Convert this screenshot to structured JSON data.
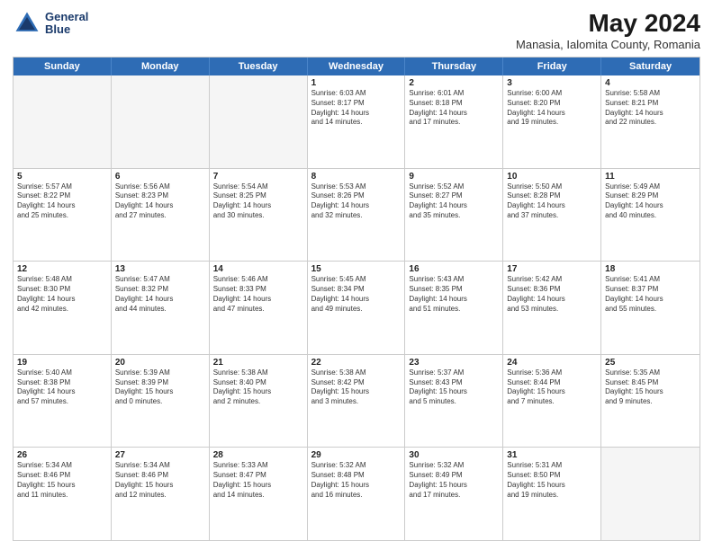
{
  "header": {
    "logo_line1": "General",
    "logo_line2": "Blue",
    "main_title": "May 2024",
    "subtitle": "Manasia, Ialomita County, Romania"
  },
  "day_headers": [
    "Sunday",
    "Monday",
    "Tuesday",
    "Wednesday",
    "Thursday",
    "Friday",
    "Saturday"
  ],
  "weeks": [
    [
      {
        "num": "",
        "info": ""
      },
      {
        "num": "",
        "info": ""
      },
      {
        "num": "",
        "info": ""
      },
      {
        "num": "1",
        "info": "Sunrise: 6:03 AM\nSunset: 8:17 PM\nDaylight: 14 hours\nand 14 minutes."
      },
      {
        "num": "2",
        "info": "Sunrise: 6:01 AM\nSunset: 8:18 PM\nDaylight: 14 hours\nand 17 minutes."
      },
      {
        "num": "3",
        "info": "Sunrise: 6:00 AM\nSunset: 8:20 PM\nDaylight: 14 hours\nand 19 minutes."
      },
      {
        "num": "4",
        "info": "Sunrise: 5:58 AM\nSunset: 8:21 PM\nDaylight: 14 hours\nand 22 minutes."
      }
    ],
    [
      {
        "num": "5",
        "info": "Sunrise: 5:57 AM\nSunset: 8:22 PM\nDaylight: 14 hours\nand 25 minutes."
      },
      {
        "num": "6",
        "info": "Sunrise: 5:56 AM\nSunset: 8:23 PM\nDaylight: 14 hours\nand 27 minutes."
      },
      {
        "num": "7",
        "info": "Sunrise: 5:54 AM\nSunset: 8:25 PM\nDaylight: 14 hours\nand 30 minutes."
      },
      {
        "num": "8",
        "info": "Sunrise: 5:53 AM\nSunset: 8:26 PM\nDaylight: 14 hours\nand 32 minutes."
      },
      {
        "num": "9",
        "info": "Sunrise: 5:52 AM\nSunset: 8:27 PM\nDaylight: 14 hours\nand 35 minutes."
      },
      {
        "num": "10",
        "info": "Sunrise: 5:50 AM\nSunset: 8:28 PM\nDaylight: 14 hours\nand 37 minutes."
      },
      {
        "num": "11",
        "info": "Sunrise: 5:49 AM\nSunset: 8:29 PM\nDaylight: 14 hours\nand 40 minutes."
      }
    ],
    [
      {
        "num": "12",
        "info": "Sunrise: 5:48 AM\nSunset: 8:30 PM\nDaylight: 14 hours\nand 42 minutes."
      },
      {
        "num": "13",
        "info": "Sunrise: 5:47 AM\nSunset: 8:32 PM\nDaylight: 14 hours\nand 44 minutes."
      },
      {
        "num": "14",
        "info": "Sunrise: 5:46 AM\nSunset: 8:33 PM\nDaylight: 14 hours\nand 47 minutes."
      },
      {
        "num": "15",
        "info": "Sunrise: 5:45 AM\nSunset: 8:34 PM\nDaylight: 14 hours\nand 49 minutes."
      },
      {
        "num": "16",
        "info": "Sunrise: 5:43 AM\nSunset: 8:35 PM\nDaylight: 14 hours\nand 51 minutes."
      },
      {
        "num": "17",
        "info": "Sunrise: 5:42 AM\nSunset: 8:36 PM\nDaylight: 14 hours\nand 53 minutes."
      },
      {
        "num": "18",
        "info": "Sunrise: 5:41 AM\nSunset: 8:37 PM\nDaylight: 14 hours\nand 55 minutes."
      }
    ],
    [
      {
        "num": "19",
        "info": "Sunrise: 5:40 AM\nSunset: 8:38 PM\nDaylight: 14 hours\nand 57 minutes."
      },
      {
        "num": "20",
        "info": "Sunrise: 5:39 AM\nSunset: 8:39 PM\nDaylight: 15 hours\nand 0 minutes."
      },
      {
        "num": "21",
        "info": "Sunrise: 5:38 AM\nSunset: 8:40 PM\nDaylight: 15 hours\nand 2 minutes."
      },
      {
        "num": "22",
        "info": "Sunrise: 5:38 AM\nSunset: 8:42 PM\nDaylight: 15 hours\nand 3 minutes."
      },
      {
        "num": "23",
        "info": "Sunrise: 5:37 AM\nSunset: 8:43 PM\nDaylight: 15 hours\nand 5 minutes."
      },
      {
        "num": "24",
        "info": "Sunrise: 5:36 AM\nSunset: 8:44 PM\nDaylight: 15 hours\nand 7 minutes."
      },
      {
        "num": "25",
        "info": "Sunrise: 5:35 AM\nSunset: 8:45 PM\nDaylight: 15 hours\nand 9 minutes."
      }
    ],
    [
      {
        "num": "26",
        "info": "Sunrise: 5:34 AM\nSunset: 8:46 PM\nDaylight: 15 hours\nand 11 minutes."
      },
      {
        "num": "27",
        "info": "Sunrise: 5:34 AM\nSunset: 8:46 PM\nDaylight: 15 hours\nand 12 minutes."
      },
      {
        "num": "28",
        "info": "Sunrise: 5:33 AM\nSunset: 8:47 PM\nDaylight: 15 hours\nand 14 minutes."
      },
      {
        "num": "29",
        "info": "Sunrise: 5:32 AM\nSunset: 8:48 PM\nDaylight: 15 hours\nand 16 minutes."
      },
      {
        "num": "30",
        "info": "Sunrise: 5:32 AM\nSunset: 8:49 PM\nDaylight: 15 hours\nand 17 minutes."
      },
      {
        "num": "31",
        "info": "Sunrise: 5:31 AM\nSunset: 8:50 PM\nDaylight: 15 hours\nand 19 minutes."
      },
      {
        "num": "",
        "info": ""
      }
    ]
  ]
}
